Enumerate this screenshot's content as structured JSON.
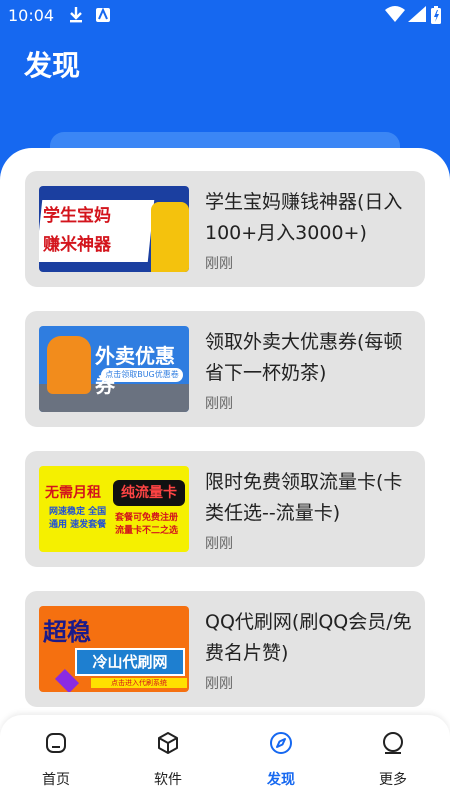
{
  "status_bar": {
    "time": "10:04",
    "icons": [
      "download-icon",
      "app-notification-icon",
      "wifi-icon",
      "signal-icon",
      "battery-icon"
    ]
  },
  "header": {
    "title": "发现"
  },
  "colors": {
    "primary": "#1668f0",
    "card_bg": "#e3e3e3",
    "active_nav": "#1668f0"
  },
  "cards": [
    {
      "title": "学生宝妈赚钱神器(日入100+月入3000+)",
      "time": "刚刚",
      "thumb_text": [
        "学生宝妈",
        "赚米神器"
      ]
    },
    {
      "title": "领取外卖大优惠券(每顿省下一杯奶茶)",
      "time": "刚刚",
      "thumb_text": [
        "外卖优惠券",
        "点击领取BUG优惠卷"
      ]
    },
    {
      "title": "限时免费领取流量卡(卡类任选--流量卡)",
      "time": "刚刚",
      "thumb_text": [
        "无需月租",
        "网速稳定 全国通用 速发套餐",
        "纯流量卡",
        "套餐可免费注册 流量卡不二之选"
      ]
    },
    {
      "title": "QQ代刷网(刷QQ会员/免费名片赞)",
      "time": "刚刚",
      "thumb_text": [
        "超稳",
        "冷山代刷网",
        "点击进入代刷系统"
      ]
    }
  ],
  "bottom_nav": {
    "items": [
      {
        "label": "首页",
        "icon": "home-icon",
        "active": false
      },
      {
        "label": "软件",
        "icon": "cube-icon",
        "active": false
      },
      {
        "label": "发现",
        "icon": "compass-icon",
        "active": true
      },
      {
        "label": "更多",
        "icon": "more-circle-icon",
        "active": false
      }
    ]
  }
}
